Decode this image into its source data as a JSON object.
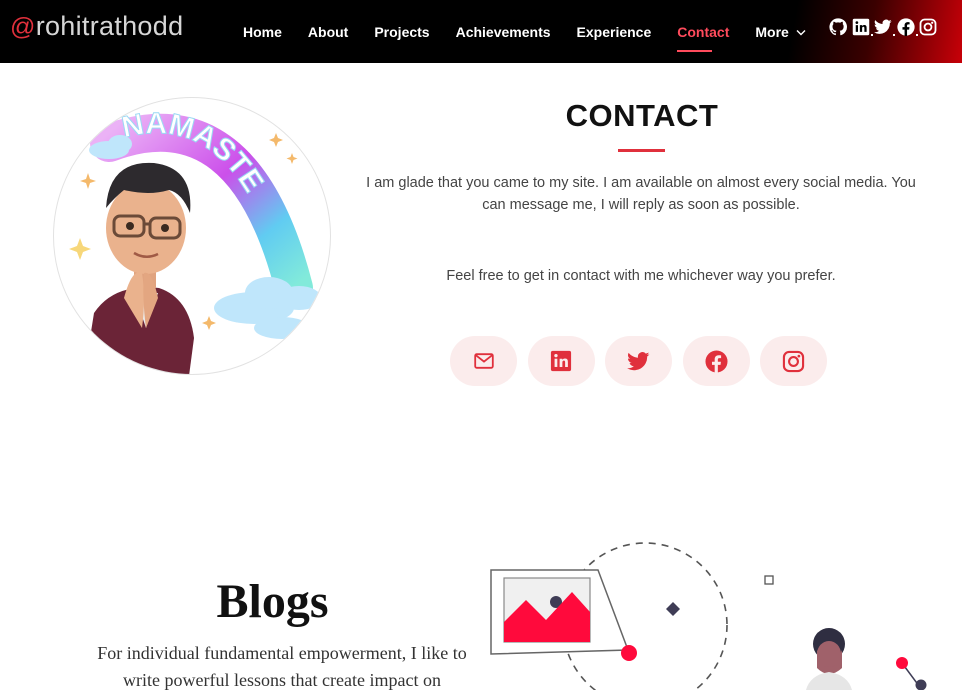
{
  "brand": {
    "at": "@",
    "name": "rohitrathodd"
  },
  "nav": {
    "links": [
      "Home",
      "About",
      "Projects",
      "Achievements",
      "Experience",
      "Contact"
    ],
    "active": "Contact",
    "more_label": "More",
    "icons": [
      "github-icon",
      "linkedin-icon",
      "twitter-icon",
      "facebook-icon",
      "instagram-icon"
    ]
  },
  "contact": {
    "title": "CONTACT",
    "paragraph1": "I am glade that you came to my site. I am available on almost every social media. You can message me, I will reply as soon as possible.",
    "paragraph2": "Feel free to get in contact with me whichever way you prefer.",
    "avatar_text": "NAMASTE",
    "social": [
      "email-icon",
      "linkedin-icon",
      "twitter-icon",
      "facebook-icon",
      "instagram-icon"
    ]
  },
  "blogs": {
    "title": "Blogs",
    "text": "For individual fundamental empowerment, I like to write powerful lessons that create impact on"
  },
  "colors": {
    "accent": "#e0303c",
    "navbar": "#000000",
    "social_bg": "#fbecec",
    "text": "#444444"
  }
}
